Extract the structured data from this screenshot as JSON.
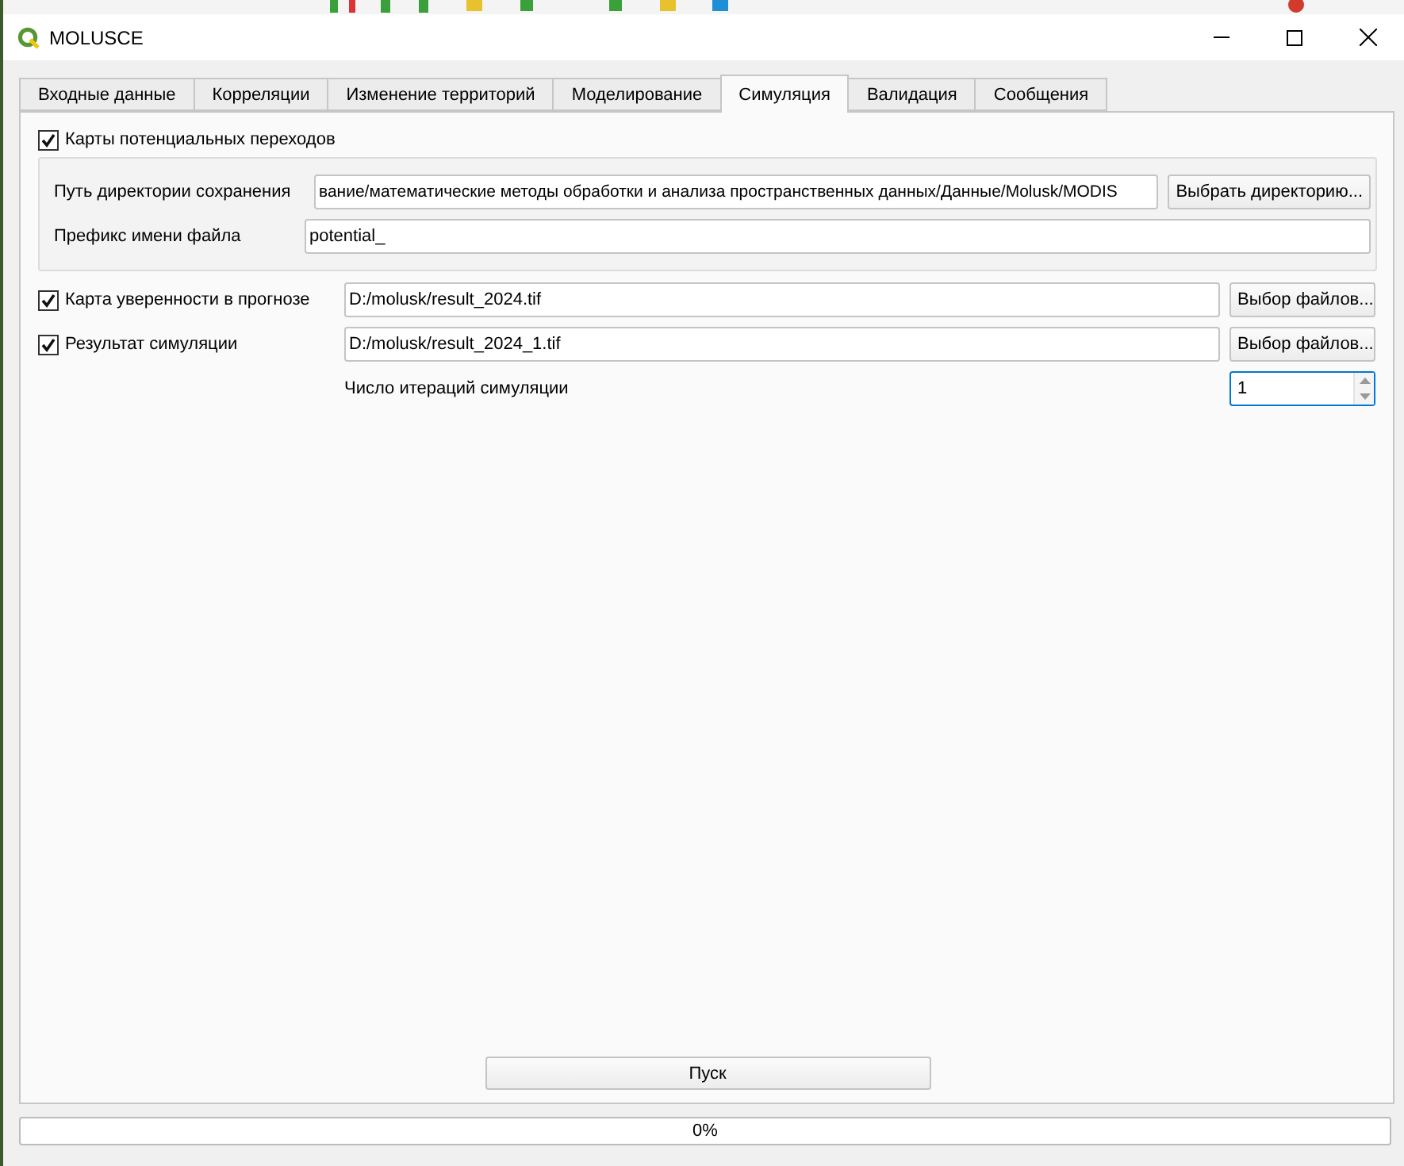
{
  "window": {
    "title": "MOLUSCE"
  },
  "tabs": [
    {
      "label": "Входные данные",
      "selected": false
    },
    {
      "label": "Корреляции",
      "selected": false
    },
    {
      "label": "Изменение территорий",
      "selected": false
    },
    {
      "label": "Моделирование",
      "selected": false
    },
    {
      "label": "Симуляция",
      "selected": true
    },
    {
      "label": "Валидация",
      "selected": false
    },
    {
      "label": "Сообщения",
      "selected": false
    }
  ],
  "potential_maps": {
    "label": "Карты потенциальных переходов",
    "checked": true,
    "save_dir": {
      "label": "Путь директории сохранения",
      "value": "вание/математические методы обработки и анализа пространственных данных/Данные/Molusk/MODIS",
      "button": "Выбрать директорию..."
    },
    "file_prefix": {
      "label": "Префикс имени файла",
      "value": "potential_"
    }
  },
  "outputs": [
    {
      "label": "Карта уверенности в прогнозе",
      "checked": true,
      "value": "D:/molusk/result_2024.tif",
      "button": "Выбор файлов..."
    },
    {
      "label": "Результат симуляции",
      "checked": true,
      "value": "D:/molusk/result_2024_1.tif",
      "button": "Выбор файлов..."
    }
  ],
  "iterations": {
    "label": "Число итераций симуляции",
    "value": "1",
    "focused": true
  },
  "run_button": "Пуск",
  "progress": {
    "level": 0,
    "text": "0%"
  }
}
